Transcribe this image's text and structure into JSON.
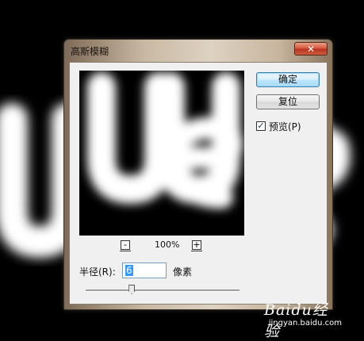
{
  "dialog": {
    "title": "高斯模糊",
    "close_label": "✕",
    "zoom": {
      "minus_label": "-",
      "level": "100%",
      "plus_label": "+"
    },
    "ok_label": "确定",
    "reset_label": "复位",
    "preview": {
      "label": "预览(P)",
      "checked": true,
      "check_mark": "✓"
    },
    "radius": {
      "label": "半径(R):",
      "value": "6",
      "unit": "像素"
    },
    "slider_level_fraction": 0.3
  },
  "watermark": {
    "brand": "Baidu经验",
    "url": "jingyan.baidu.com"
  }
}
